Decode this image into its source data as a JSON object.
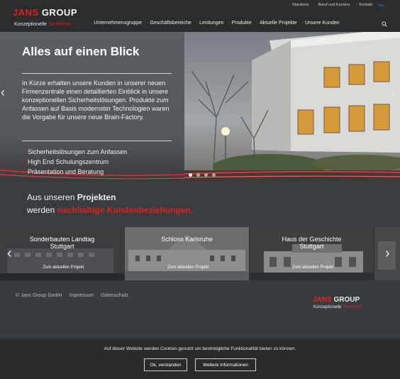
{
  "brand": {
    "name_part1": "JANS",
    "name_part2": "GROUP",
    "tagline_part1": "Konzeptionelle",
    "tagline_part2": "Sicherheit"
  },
  "topbar": {
    "links": [
      "Standorte",
      "Beruf und Karriere",
      "Kontakt"
    ],
    "language_icon": "uk-flag-icon"
  },
  "nav": {
    "items": [
      "Unternehmensgruppe",
      "Geschäftsbereiche",
      "Leistungen",
      "Produkte",
      "Aktuelle Projekte",
      "Unsere Kunden"
    ],
    "search_icon": "search-icon"
  },
  "hero": {
    "title": "Alles auf einen Blick",
    "text": "In Kürze erhalten unsere Kunden in unserer neuen Firmenzentrale einen detaillierten Einblick in unsere konzeptionellen Sicherheitslösungen. Produkte zum Anfassen auf Basis modernster Technologien waren die Vorgabe für unsere neue Brain-Factory.",
    "list": [
      "Sicherheitslösungen zum Anfassen",
      "High End Schulungszentrum",
      "Präsentation und Beratung"
    ],
    "slides_count": 4,
    "active_slide": 1
  },
  "projects_intro": {
    "line1_prefix": "Aus unseren ",
    "line1_bold": "Projekten",
    "line2_prefix": "werden ",
    "line2_red": "nachhaltige Kundenbeziehungen."
  },
  "projects": [
    {
      "title_line1": "Sonderbauten Landtag",
      "title_line2": "Stuttgart",
      "link": "Zum aktuellen Projekt"
    },
    {
      "title_line1": "Schloss Karlsruhe",
      "title_line2": "",
      "link": "Zum aktuellen Projekt"
    },
    {
      "title_line1": "Haus der Geschichte",
      "title_line2": "Stuttgart",
      "link": "Zum aktuellen Projekt"
    }
  ],
  "footer": {
    "links": [
      "© Jans Group GmbH",
      "Impressum",
      "Datenschutz"
    ]
  },
  "cookie": {
    "text": "Auf dieser Website werden Cookies genutzt um bestmögliche Funktionalität bieten zu können.",
    "accept_label": "Ok, verstanden",
    "more_label": "Weitere Informationen"
  },
  "colors": {
    "accent": "#e02020",
    "header_bg": "#2a2c2e",
    "body_bg": "#3a3d40"
  }
}
